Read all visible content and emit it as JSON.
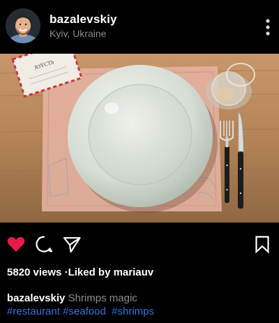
{
  "header": {
    "username": "bazalevskiy",
    "location": "Kyiv, Ukraine",
    "avatar_icon": "user-avatar",
    "more_icon": "more-vertical-icon"
  },
  "photo": {
    "card_text": "JOŸCTb"
  },
  "actions": {
    "like_icon": "heart-icon",
    "like_color": "#e8194b",
    "comment_icon": "comment-icon",
    "share_icon": "send-icon",
    "save_icon": "bookmark-icon"
  },
  "stats": {
    "views": "5820 views",
    "separator": "·",
    "liked_by": "Liked by mariauv"
  },
  "caption": {
    "username": "bazalevskiy",
    "text": "Shrimps magic",
    "tags": [
      "#restaurant",
      "#seafood",
      "#shrimps"
    ],
    "tag_color": "#2d74d8"
  }
}
